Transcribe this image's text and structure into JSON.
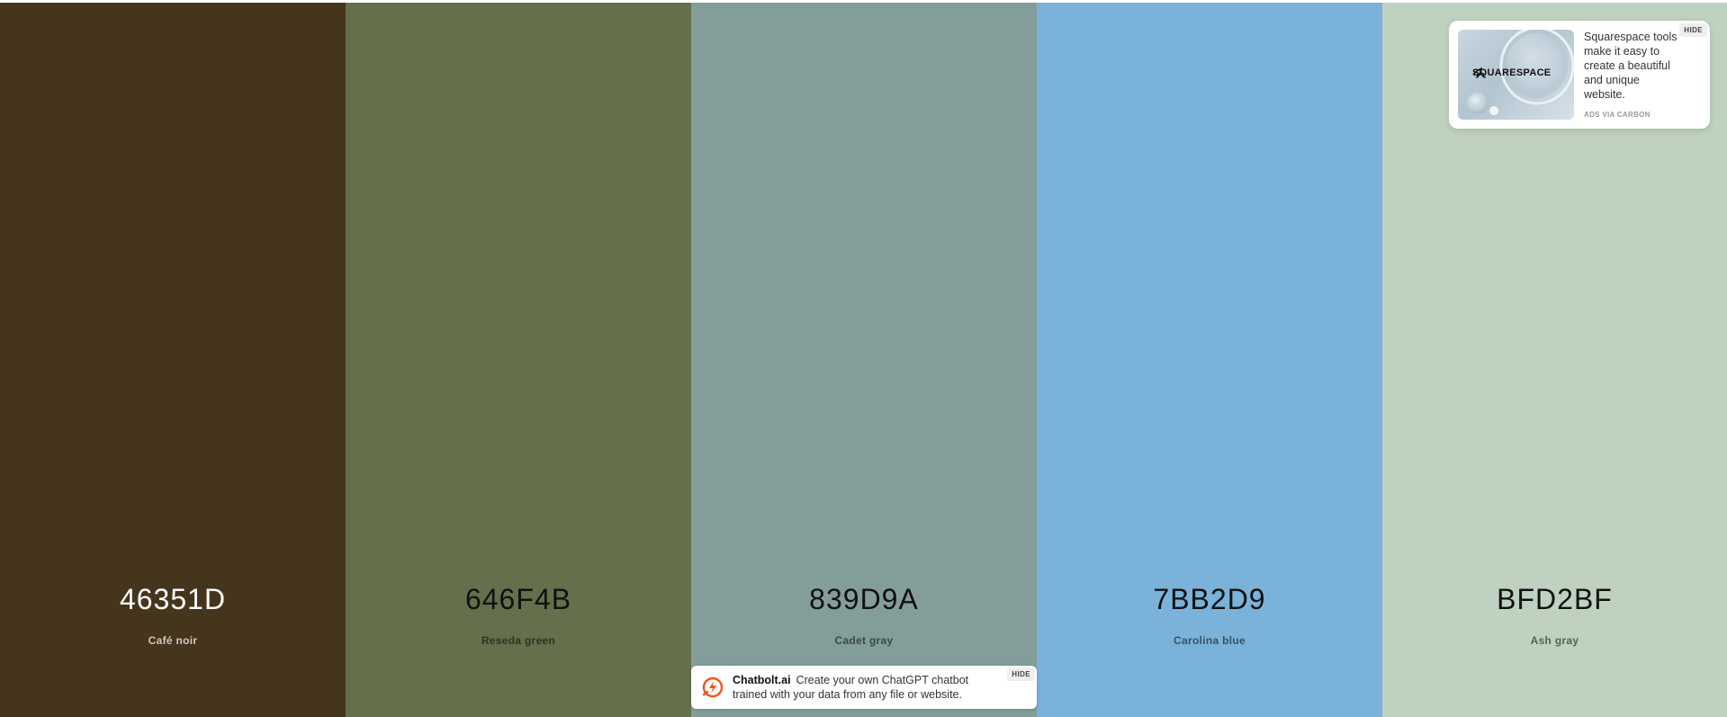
{
  "palette": {
    "swatches": [
      {
        "hex": "46351D",
        "name": "Café noir",
        "color": "#46351D",
        "tone": "dark"
      },
      {
        "hex": "646F4B",
        "name": "Reseda green",
        "color": "#646F4B",
        "tone": "light"
      },
      {
        "hex": "839D9A",
        "name": "Cadet gray",
        "color": "#839D9A",
        "tone": "light"
      },
      {
        "hex": "7BB2D9",
        "name": "Carolina blue",
        "color": "#7BB2D9",
        "tone": "light"
      },
      {
        "hex": "BFD2BF",
        "name": "Ash gray",
        "color": "#BFD2BF",
        "tone": "light"
      }
    ]
  },
  "carbon_ad": {
    "brand": "SQUARESPACE",
    "text": "Squarespace tools make it easy to create a beautiful and unique website.",
    "via": "ADS VIA CARBON",
    "hide_label": "HIDE"
  },
  "bottom_ad": {
    "brand": "Chatbolt.ai",
    "text": "Create your own ChatGPT chatbot trained with your data from any file or website.",
    "hide_label": "HIDE",
    "accent": "#F2541B"
  }
}
